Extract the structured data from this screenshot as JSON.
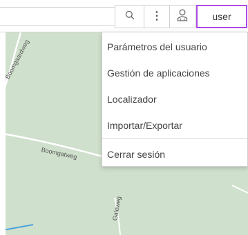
{
  "toolbar": {
    "search_icon": "search-icon",
    "menu_icon": "vertical-ellipsis-icon",
    "menu_glyph": "⋮",
    "user_icon": "user-icon",
    "user_label": "user",
    "accent_color": "#b04ae6"
  },
  "map": {
    "street_labels": [
      "Boomgaardweg",
      "Boomgatweg",
      "Galeweg"
    ]
  },
  "user_menu": {
    "items": [
      {
        "label": "Parámetros del usuario"
      },
      {
        "label": "Gestión de aplicaciones"
      },
      {
        "label": "Localizador"
      },
      {
        "label": "Importar/Exportar"
      },
      {
        "label": "Cerrar sesión"
      }
    ]
  }
}
